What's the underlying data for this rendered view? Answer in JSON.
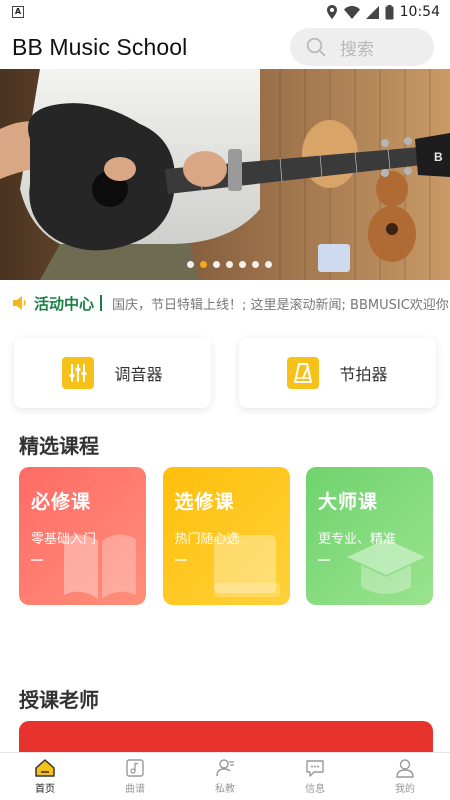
{
  "status_bar": {
    "time": "10:54",
    "left_badge": "A"
  },
  "header": {
    "title": "BB Music School",
    "search_placeholder": "搜索"
  },
  "banner": {
    "brand_mark": "B",
    "slide_count": 7,
    "active_slide": 2
  },
  "ticker": {
    "label": "活动中心",
    "text": "国庆，节日特辑上线！; 这里是滚动新闻; BBMUSIC欢迎你"
  },
  "tools": [
    {
      "label": "调音器",
      "icon": "tuner-sliders-icon"
    },
    {
      "label": "节拍器",
      "icon": "metronome-icon"
    }
  ],
  "courses_section": {
    "title": "精选课程"
  },
  "courses": [
    {
      "title": "必修课",
      "subtitle": "零基础入门",
      "color": "#ff7a6f",
      "icon": "book-icon"
    },
    {
      "title": "选修课",
      "subtitle": "热门随心选",
      "color": "#ffc414",
      "icon": "closed-book-icon"
    },
    {
      "title": "大师课",
      "subtitle": "更专业、精准",
      "color": "#7fd879",
      "icon": "graduation-cap-icon"
    }
  ],
  "teachers_section": {
    "title": "授课老师"
  },
  "colors": {
    "accent": "#f6c21a",
    "ticker": "#1a7f46",
    "teacher_card": "#e8322e"
  },
  "nav": [
    {
      "label": "首页",
      "icon": "home-icon",
      "active": true
    },
    {
      "label": "曲谱",
      "icon": "sheet-music-icon",
      "active": false
    },
    {
      "label": "私教",
      "icon": "tutor-icon",
      "active": false
    },
    {
      "label": "信息",
      "icon": "message-icon",
      "active": false
    },
    {
      "label": "我的",
      "icon": "profile-icon",
      "active": false
    }
  ]
}
